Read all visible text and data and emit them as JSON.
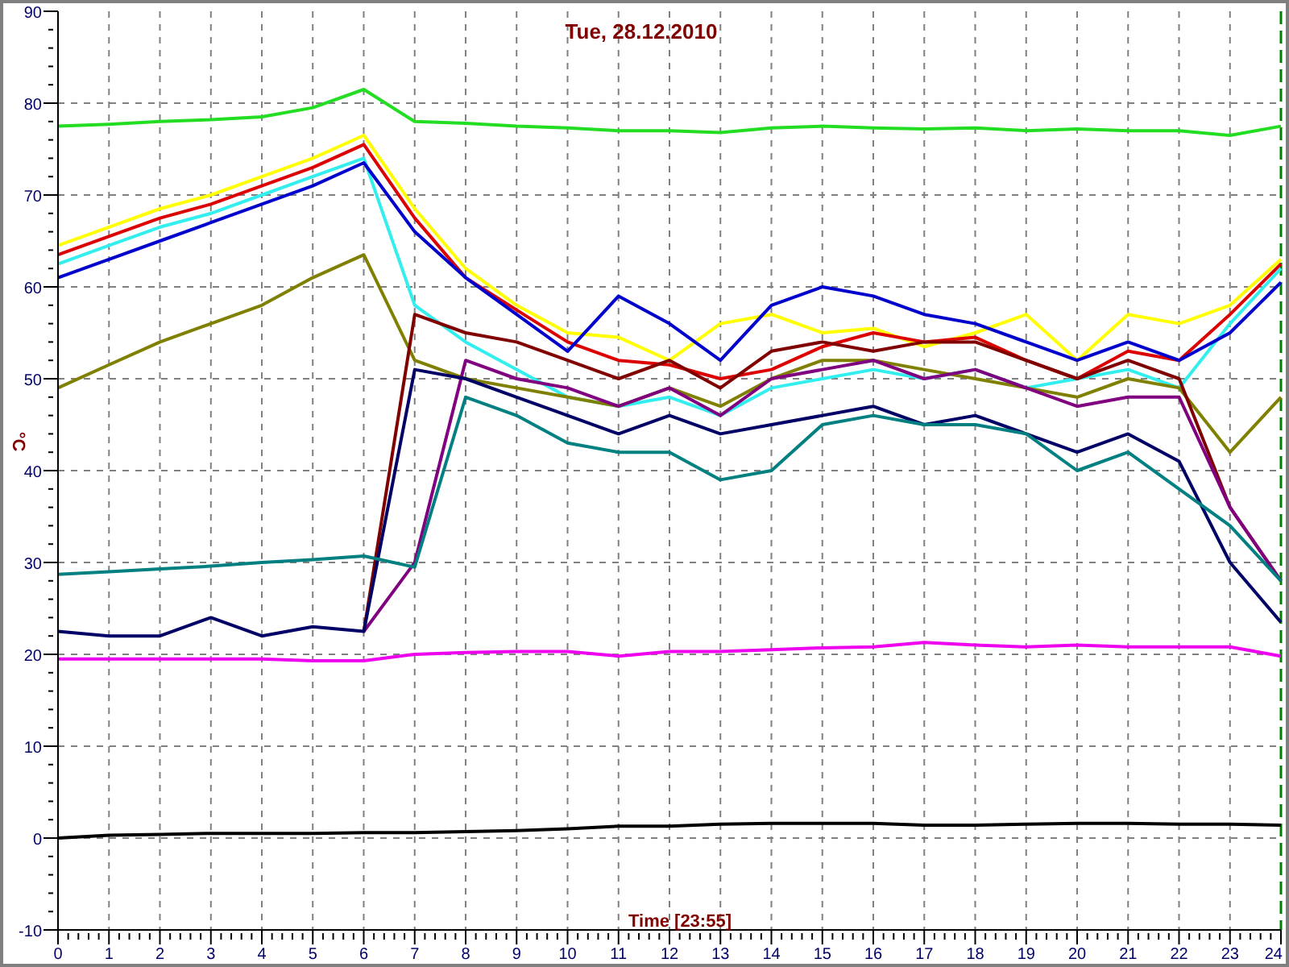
{
  "chart_data": {
    "type": "line",
    "title": "Tue, 28.12.2010",
    "xlabel": "Time [23:55]",
    "ylabel": "°C",
    "x": [
      0,
      1,
      2,
      3,
      4,
      5,
      6,
      7,
      8,
      9,
      10,
      11,
      12,
      13,
      14,
      15,
      16,
      17,
      18,
      19,
      20,
      21,
      22,
      23,
      24
    ],
    "series": [
      {
        "color": "#22dd22",
        "values": [
          77.5,
          77.7,
          78,
          78.2,
          78.5,
          79.5,
          81.5,
          78,
          77.8,
          77.5,
          77.3,
          77,
          77,
          76.8,
          77.3,
          77.5,
          77.3,
          77.2,
          77.3,
          77,
          77.2,
          77,
          77,
          76.5,
          77.5
        ]
      },
      {
        "color": "#ffff00",
        "values": [
          64.5,
          66.5,
          68.5,
          70,
          72,
          74,
          76.5,
          68.5,
          62,
          58,
          55,
          54.5,
          52,
          56,
          57,
          55,
          55.5,
          53.5,
          55,
          57,
          52,
          57,
          56,
          58,
          63
        ]
      },
      {
        "color": "#dd0000",
        "values": [
          63.5,
          65.5,
          67.5,
          69,
          71,
          73,
          75.5,
          67.5,
          61,
          57.5,
          54,
          52,
          51.5,
          50,
          51,
          53.5,
          55,
          54,
          54.5,
          52,
          50,
          53,
          52,
          57,
          62.5
        ]
      },
      {
        "color": "#33eeee",
        "values": [
          62.5,
          64.5,
          66.5,
          68,
          70,
          72,
          74,
          58,
          54,
          51,
          48,
          47,
          48,
          46,
          49,
          50,
          51,
          50,
          51,
          49,
          50,
          51,
          49,
          56,
          62
        ]
      },
      {
        "color": "#0000cc",
        "values": [
          61,
          63,
          65,
          67,
          69,
          71,
          73.5,
          66,
          61,
          57,
          53,
          59,
          56,
          52,
          58,
          60,
          59,
          57,
          56,
          54,
          52,
          54,
          52,
          55,
          60.5
        ]
      },
      {
        "color": "#808000",
        "values": [
          49,
          51.5,
          54,
          56,
          58,
          61,
          63.5,
          52,
          50,
          49,
          48,
          47,
          49,
          47,
          50,
          52,
          52,
          51,
          50,
          49,
          48,
          50,
          49,
          42,
          48
        ]
      },
      {
        "color": "#800000",
        "values": [
          null,
          null,
          null,
          null,
          null,
          null,
          22.5,
          57,
          55,
          54,
          52,
          50,
          52,
          49,
          53,
          54,
          53,
          54,
          54,
          52,
          50,
          52,
          50,
          36,
          28
        ]
      },
      {
        "color": "#800080",
        "values": [
          null,
          null,
          null,
          null,
          null,
          null,
          22.5,
          30,
          52,
          50,
          49,
          47,
          49,
          46,
          50,
          51,
          52,
          50,
          51,
          49,
          47,
          48,
          48,
          36,
          28
        ]
      },
      {
        "color": "#000066",
        "values": [
          22.5,
          22,
          22,
          24,
          22,
          23,
          22.5,
          51,
          50,
          48,
          46,
          44,
          46,
          44,
          45,
          46,
          47,
          45,
          46,
          44,
          42,
          44,
          41,
          30,
          23.5
        ]
      },
      {
        "color": "#008080",
        "values": [
          28.7,
          29,
          29.3,
          29.6,
          30,
          30.3,
          30.7,
          29.5,
          48,
          46,
          43,
          42,
          42,
          39,
          40,
          45,
          46,
          45,
          45,
          44,
          40,
          42,
          38,
          34,
          28
        ]
      },
      {
        "color": "#ee00ee",
        "values": [
          19.5,
          19.5,
          19.5,
          19.5,
          19.5,
          19.3,
          19.3,
          20,
          20.2,
          20.3,
          20.3,
          19.8,
          20.3,
          20.3,
          20.5,
          20.7,
          20.8,
          21.3,
          21,
          20.8,
          21,
          20.8,
          20.8,
          20.8,
          19.8
        ]
      },
      {
        "color": "#000000",
        "values": [
          0,
          0.3,
          0.4,
          0.5,
          0.5,
          0.5,
          0.6,
          0.6,
          0.7,
          0.8,
          1,
          1.3,
          1.3,
          1.5,
          1.6,
          1.6,
          1.6,
          1.4,
          1.4,
          1.5,
          1.6,
          1.6,
          1.5,
          1.5,
          1.4
        ]
      }
    ],
    "grid": true,
    "xlim": [
      0,
      24
    ],
    "ylim": [
      -10,
      90
    ],
    "xticks": [
      0,
      1,
      2,
      3,
      4,
      5,
      6,
      7,
      8,
      9,
      10,
      11,
      12,
      13,
      14,
      15,
      16,
      17,
      18,
      19,
      20,
      21,
      22,
      23,
      24
    ],
    "yticks": [
      -10,
      0,
      10,
      20,
      30,
      40,
      50,
      60,
      70,
      80,
      90
    ]
  }
}
